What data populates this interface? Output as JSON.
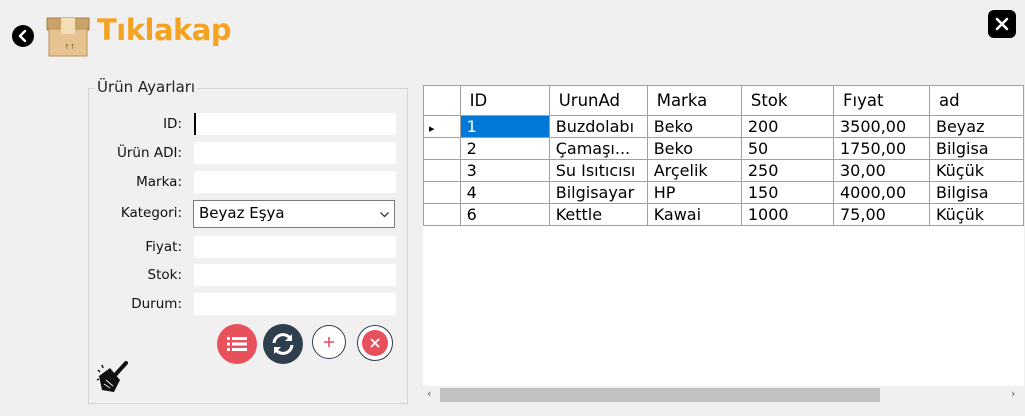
{
  "app": {
    "title": "Tıklakap",
    "accent_color": "#f4a21f"
  },
  "form": {
    "group_title": "Ürün Ayarları",
    "fields": [
      {
        "label": "ID:",
        "value": ""
      },
      {
        "label": "Ürün ADI:",
        "value": ""
      },
      {
        "label": "Marka:",
        "value": ""
      },
      {
        "label": "Kategori:",
        "value": "Beyaz Eşya"
      },
      {
        "label": "Fiyat:",
        "value": ""
      },
      {
        "label": "Stok:",
        "value": ""
      },
      {
        "label": "Durum:",
        "value": ""
      }
    ],
    "buttons": [
      {
        "name": "list-button",
        "icon": "list-icon",
        "color": "#e8505b"
      },
      {
        "name": "refresh-button",
        "icon": "refresh-icon",
        "color": "#2f3e4d"
      },
      {
        "name": "add-button",
        "icon": "plus-icon",
        "color": "#e8505b"
      },
      {
        "name": "delete-button",
        "icon": "close-icon",
        "color": "#e8505b"
      }
    ],
    "clear_icon": "broom-icon"
  },
  "grid": {
    "columns": [
      "ID",
      "UrunAd",
      "Marka",
      "Stok",
      "Fıyat",
      "ad"
    ],
    "rows": [
      [
        "1",
        "Buzdolabı",
        "Beko",
        "200",
        "3500,00",
        "Beyaz"
      ],
      [
        "2",
        "Çamaşı...",
        "Beko",
        "50",
        "1750,00",
        "Bilgisa"
      ],
      [
        "3",
        "Su Isıtıcısı",
        "Arçelik",
        "250",
        "30,00",
        "Küçük"
      ],
      [
        "4",
        "Bilgisayar",
        "HP",
        "150",
        "4000,00",
        "Bilgisa"
      ],
      [
        "6",
        "Kettle",
        "Kawai",
        "1000",
        "75,00",
        "Küçük"
      ]
    ],
    "current_row_marker": "▸",
    "selected_color": "#0078d7"
  },
  "scrollbar": {
    "left_arrow": "‹",
    "right_arrow": "›"
  }
}
